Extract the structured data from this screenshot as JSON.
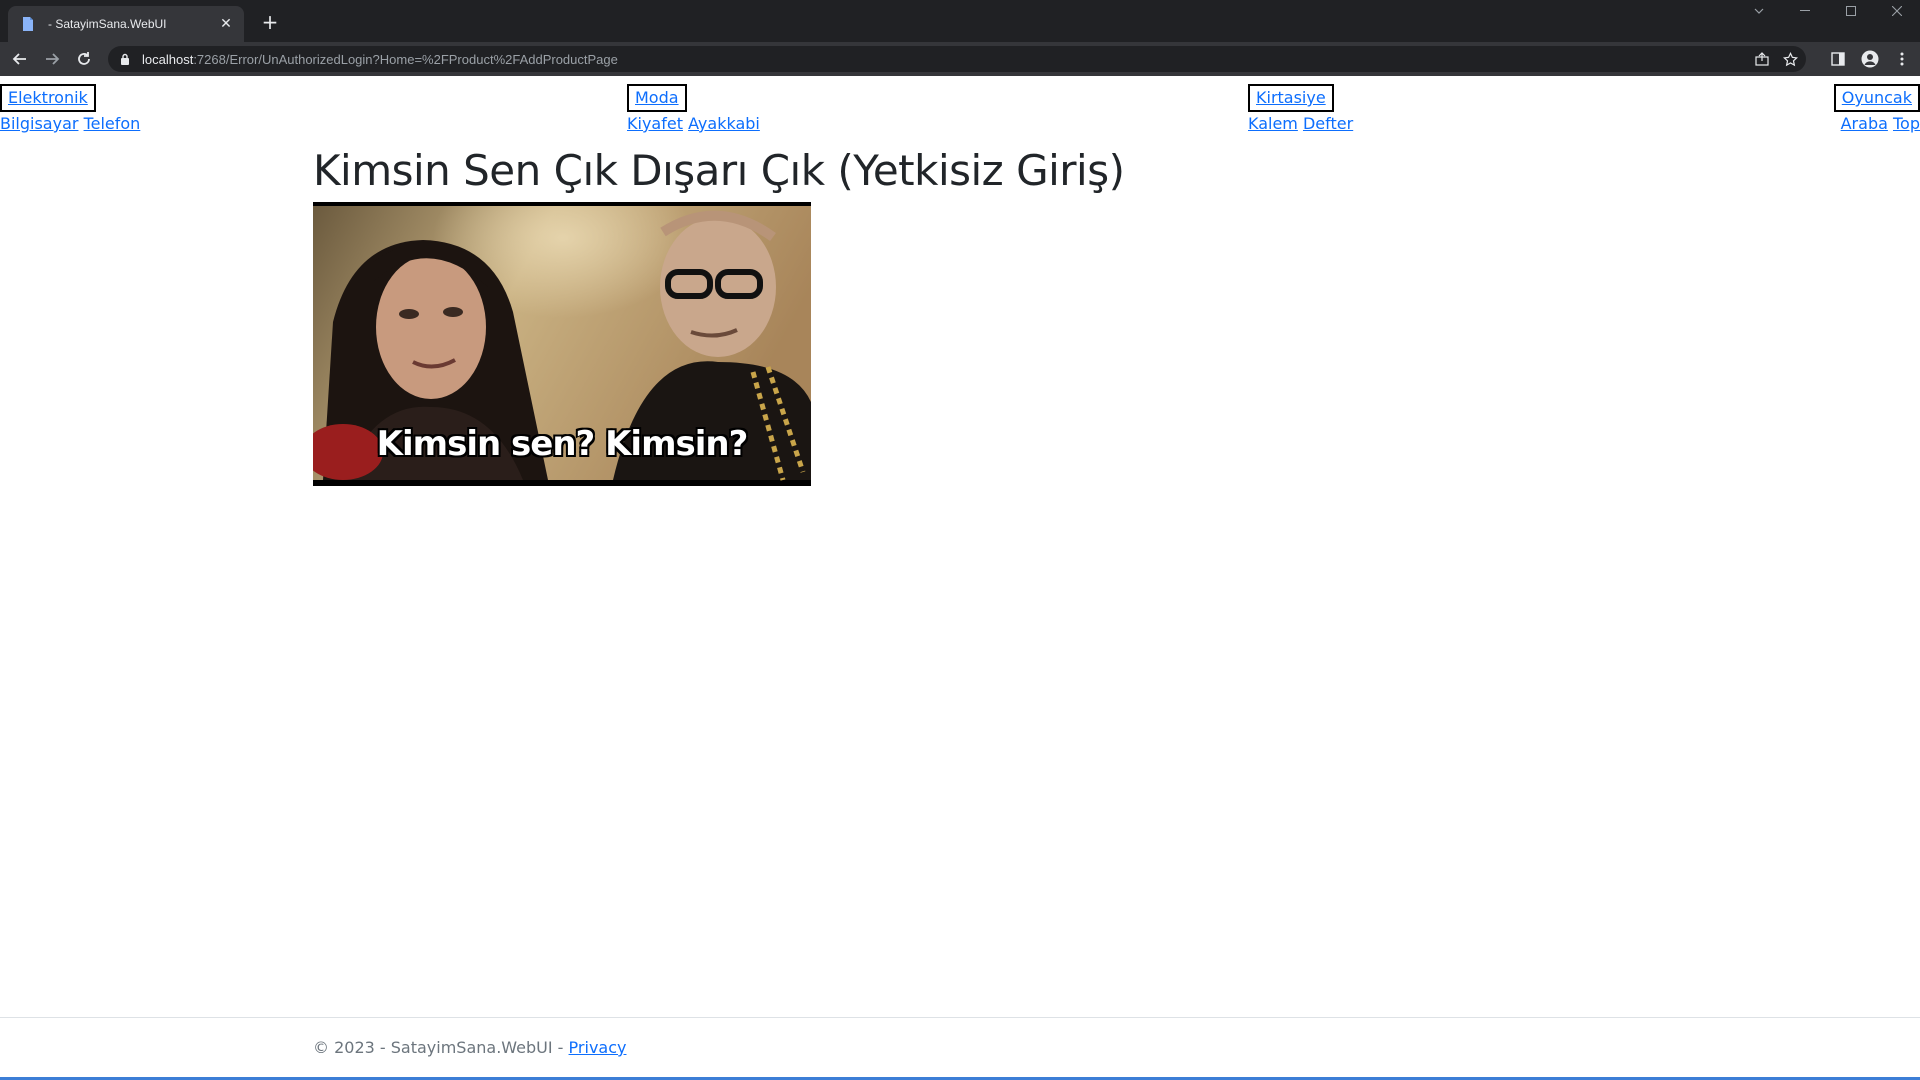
{
  "browser": {
    "tab_title": "- SatayimSana.WebUI",
    "url_host": "localhost",
    "url_path": ":7268/Error/UnAuthorizedLogin?Home=%2FProduct%2FAddProductPage"
  },
  "categories": [
    {
      "label": "Elektronik",
      "subs": [
        "Bilgisayar",
        "Telefon"
      ]
    },
    {
      "label": "Moda",
      "subs": [
        "Kiyafet",
        "Ayakkabi"
      ]
    },
    {
      "label": "Kirtasiye",
      "subs": [
        "Kalem",
        "Defter"
      ]
    },
    {
      "label": "Oyuncak",
      "subs": [
        "Araba",
        "Top"
      ]
    }
  ],
  "main": {
    "heading": "Kimsin Sen Çık Dışarı Çık (Yetkisiz Giriş)",
    "image_caption": "Kimsin sen? Kimsin?"
  },
  "footer": {
    "copyright": "© 2023 - SatayimSana.WebUI - ",
    "privacy_label": "Privacy"
  },
  "colors": {
    "link": "#0d6efd",
    "chrome_dark": "#202124",
    "chrome_toolbar": "#35363a"
  }
}
